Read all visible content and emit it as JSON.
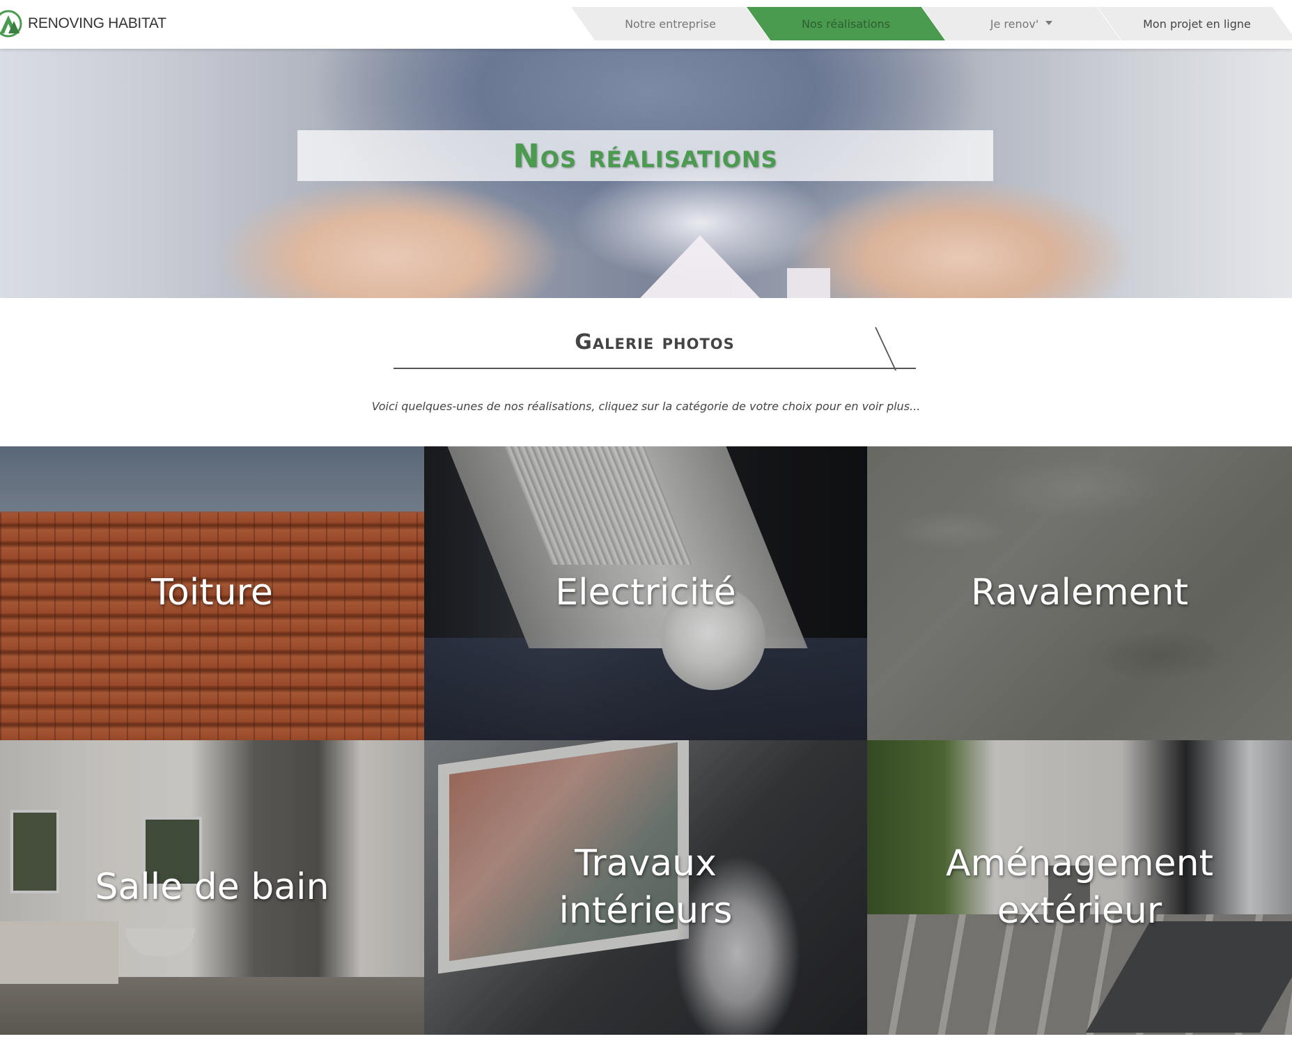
{
  "brand": {
    "name": "RENOVING HABITAT",
    "logo_icon": "renoving-habitat-logo-icon",
    "accent_color": "#4a9a4f"
  },
  "nav": {
    "items": [
      {
        "label": "Notre entreprise",
        "active": false
      },
      {
        "label": "Nos réalisations",
        "active": true
      },
      {
        "label": "Je renov'",
        "active": false,
        "has_dropdown": true
      },
      {
        "label": "Mon projet en ligne",
        "active": false
      }
    ],
    "dropdown_icon": "caret-down-icon"
  },
  "hero": {
    "title": "Nos réalisations"
  },
  "gallery_section": {
    "title": "Galerie photos",
    "intro": "Voici quelques-unes de nos réalisations, cliquez sur la catégorie de votre choix pour en voir plus..."
  },
  "categories": [
    {
      "line1": "Toiture",
      "line2": ""
    },
    {
      "line1": "Electricité",
      "line2": ""
    },
    {
      "line1": "Ravalement",
      "line2": ""
    },
    {
      "line1": "Salle de bain",
      "line2": ""
    },
    {
      "line1": "Travaux",
      "line2": "intérieurs"
    },
    {
      "line1": "Aménagement",
      "line2": "extérieur"
    }
  ]
}
